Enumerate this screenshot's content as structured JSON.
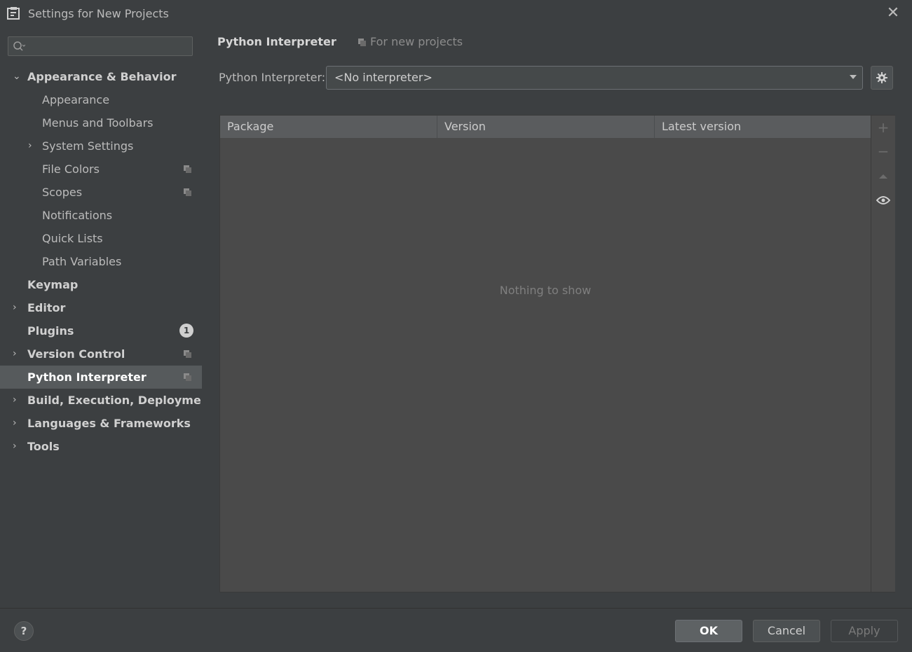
{
  "window": {
    "title": "Settings for New Projects"
  },
  "search": {
    "placeholder": "",
    "value": ""
  },
  "sidebar": {
    "items": [
      {
        "label": "Appearance & Behavior",
        "bold": true,
        "expanded": true
      },
      {
        "label": "Appearance"
      },
      {
        "label": "Menus and Toolbars"
      },
      {
        "label": "System Settings",
        "collapsed": true
      },
      {
        "label": "File Colors",
        "project_scope": true
      },
      {
        "label": "Scopes",
        "project_scope": true
      },
      {
        "label": "Notifications"
      },
      {
        "label": "Quick Lists"
      },
      {
        "label": "Path Variables"
      },
      {
        "label": "Keymap",
        "bold": true
      },
      {
        "label": "Editor",
        "bold": true,
        "collapsed": true
      },
      {
        "label": "Plugins",
        "bold": true,
        "badge": "1"
      },
      {
        "label": "Version Control",
        "bold": true,
        "collapsed": true,
        "project_scope": true
      },
      {
        "label": "Python Interpreter",
        "bold": true,
        "selected": true,
        "project_scope": true
      },
      {
        "label": "Build, Execution, Deployment",
        "bold": true,
        "collapsed": true
      },
      {
        "label": "Languages & Frameworks",
        "bold": true,
        "collapsed": true
      },
      {
        "label": "Tools",
        "bold": true,
        "collapsed": true
      }
    ]
  },
  "main": {
    "breadcrumb": "Python Interpreter",
    "scope_label": "For new projects",
    "interpreter_label": "Python Interpreter:",
    "interpreter_value": "<No interpreter>",
    "table": {
      "columns": [
        "Package",
        "Version",
        "Latest version"
      ],
      "rows": [],
      "empty_text": "Nothing to show"
    },
    "toolbar": [
      "add-icon",
      "remove-icon",
      "upgrade-icon",
      "eye-icon"
    ]
  },
  "footer": {
    "help": "?",
    "ok": "OK",
    "cancel": "Cancel",
    "apply": "Apply"
  }
}
